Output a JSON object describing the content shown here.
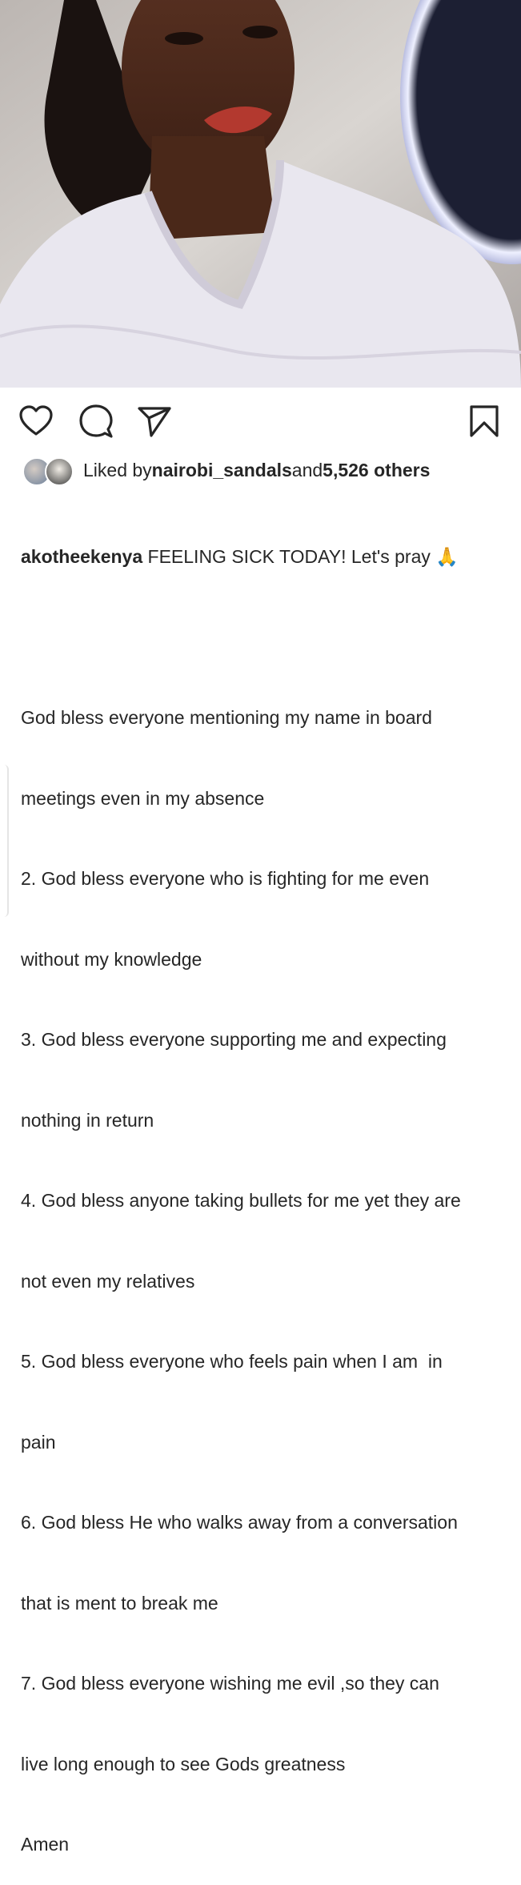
{
  "post": {
    "photo_alt_icon": "post-photo",
    "actions": {
      "like_icon": "heart-icon",
      "comment_icon": "comment-icon",
      "share_icon": "send-icon",
      "save_icon": "bookmark-icon"
    },
    "likes": {
      "prefix": "Liked by ",
      "user": "nairobi_sandals",
      "middle": " and ",
      "others": "5,526 others"
    },
    "caption": {
      "username": "akotheekenya",
      "first_line": " FEELING SICK TODAY! Let's pray 🙏",
      "lines": [
        "",
        "God bless everyone mentioning my name in board",
        "meetings even in my absence",
        "2. God bless everyone who is fighting for me even",
        "without my knowledge",
        "3. God bless everyone supporting me and expecting",
        "nothing in return",
        "4. God bless anyone taking bullets for me yet they are",
        "not even my relatives",
        "5. God bless everyone who feels pain when I am  in",
        "pain",
        "6. God bless He who walks away from a conversation",
        "that is ment to break me",
        "7. God bless everyone wishing me evil ,so they can",
        "live long enough to see Gods greatness",
        "Amen"
      ]
    }
  }
}
